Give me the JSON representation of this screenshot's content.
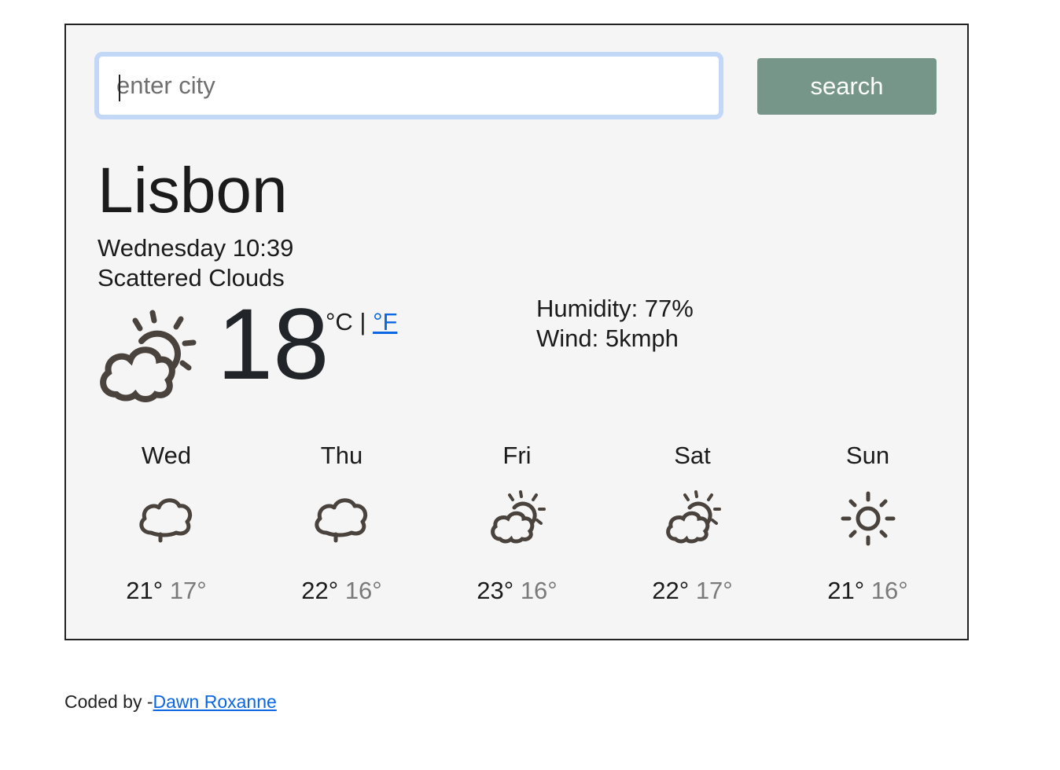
{
  "search": {
    "placeholder": "enter city",
    "button_label": "search"
  },
  "current": {
    "city": "Lisbon",
    "date": "Wednesday 10:39",
    "description": "Scattered Clouds",
    "temperature": "18",
    "unit_celsius": "°C",
    "unit_separator": " | ",
    "unit_fahrenheit": "°F",
    "icon": "partly-cloudy-icon",
    "humidity_label": "Humidity: 77%",
    "wind_label": "Wind: 5kmph"
  },
  "forecast": [
    {
      "day": "Wed",
      "max": "21°",
      "min": "17°",
      "icon": "cloud-icon"
    },
    {
      "day": "Thu",
      "max": "22°",
      "min": "16°",
      "icon": "cloud-icon"
    },
    {
      "day": "Fri",
      "max": "23°",
      "min": "16°",
      "icon": "partly-cloudy-icon"
    },
    {
      "day": "Sat",
      "max": "22°",
      "min": "17°",
      "icon": "partly-cloudy-icon"
    },
    {
      "day": "Sun",
      "max": "21°",
      "min": "16°",
      "icon": "sun-icon"
    }
  ],
  "footer": {
    "prefix": "Coded by -",
    "author_link": "Dawn Roxanne"
  },
  "colors": {
    "button_bg": "#76968a",
    "panel_bg": "#f5f5f5",
    "link": "#0b66e4",
    "input_focus_border": "#c3d7f7",
    "icon_stroke": "#4a423c"
  }
}
